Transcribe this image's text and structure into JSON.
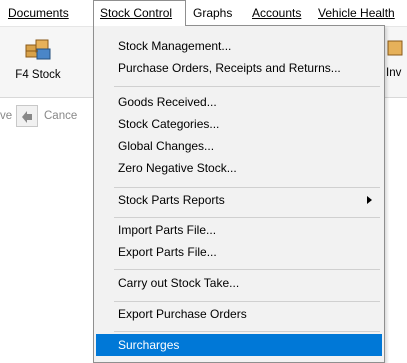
{
  "menubar": {
    "items": [
      {
        "label": "Documents"
      },
      {
        "label": "Stock Control"
      },
      {
        "label": "Graphs"
      },
      {
        "label": "Accounts"
      },
      {
        "label": "Vehicle Health"
      }
    ]
  },
  "toolbar": {
    "stock_button_label": "F4 Stock",
    "partial_right_label": "Inv",
    "partial_left_text": "ve",
    "cancel_label": "Cance"
  },
  "stock_menu": {
    "items": [
      {
        "label": "Stock Management..."
      },
      {
        "label": "Purchase Orders, Receipts and Returns..."
      },
      {
        "label": "Goods Received..."
      },
      {
        "label": "Stock Categories..."
      },
      {
        "label": "Global Changes..."
      },
      {
        "label": "Zero Negative Stock..."
      },
      {
        "label": "Stock Parts Reports"
      },
      {
        "label": "Import Parts File..."
      },
      {
        "label": "Export Parts File..."
      },
      {
        "label": "Carry out Stock Take..."
      },
      {
        "label": "Export Purchase Orders"
      },
      {
        "label": "Surcharges"
      }
    ]
  },
  "colors": {
    "selection": "#0078d7",
    "menu_background": "#f2f2f2"
  }
}
